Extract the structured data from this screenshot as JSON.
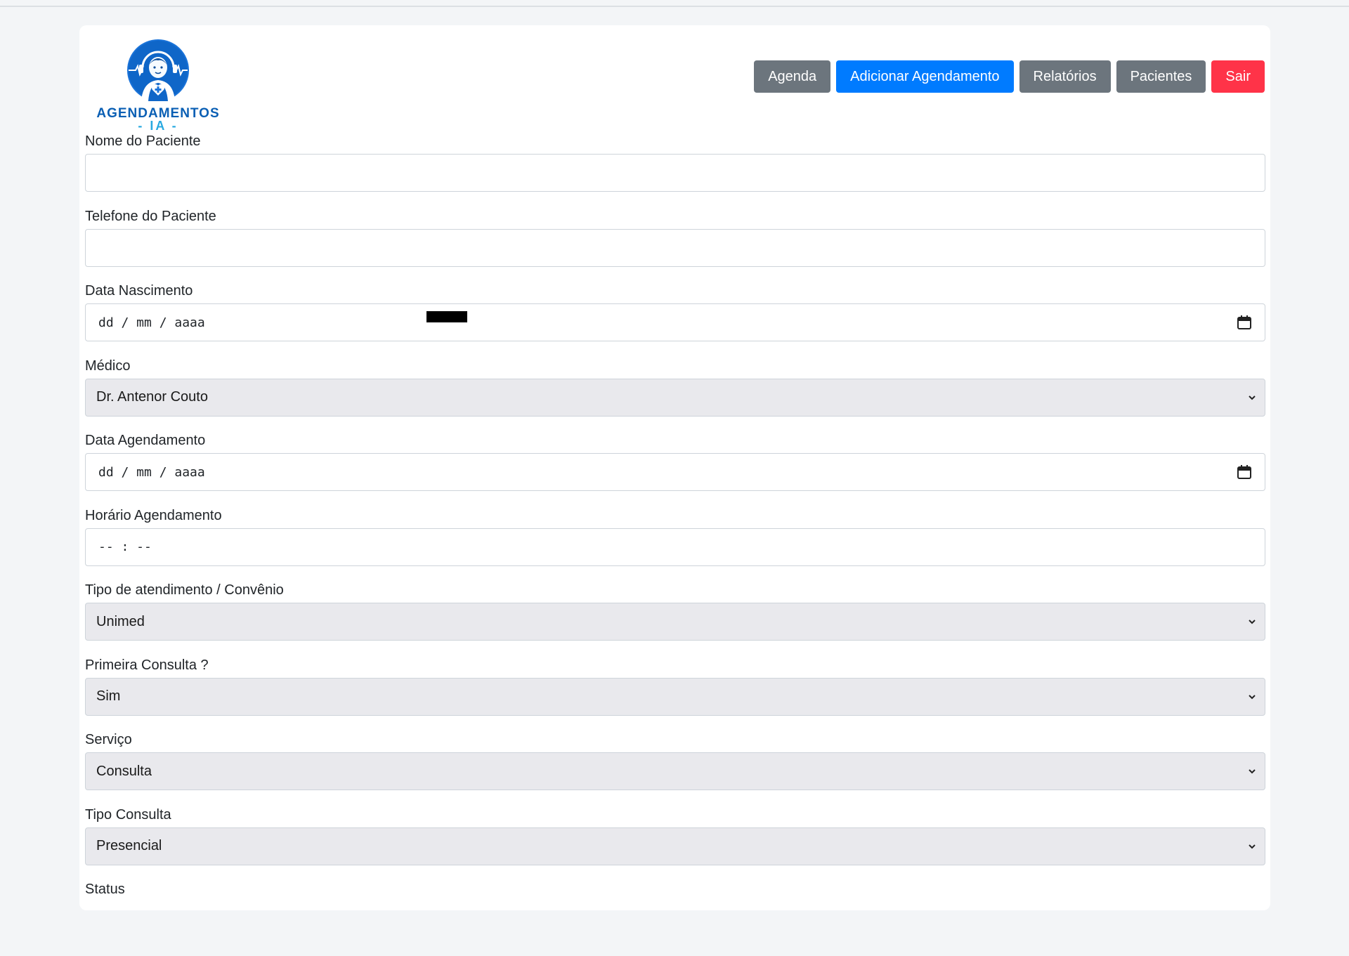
{
  "logo": {
    "line1": "AGENDAMENTOS",
    "line2": "- IA -"
  },
  "nav": {
    "agenda": "Agenda",
    "add": "Adicionar Agendamento",
    "reports": "Relatórios",
    "patients": "Pacientes",
    "logout": "Sair"
  },
  "form": {
    "patient_name": {
      "label": "Nome do Paciente",
      "value": ""
    },
    "patient_phone": {
      "label": "Telefone do Paciente",
      "value": ""
    },
    "birth_date": {
      "label": "Data Nascimento",
      "value": "dd / mm / aaaa"
    },
    "doctor": {
      "label": "Médico",
      "value": "Dr. Antenor Couto"
    },
    "appointment_date": {
      "label": "Data Agendamento",
      "value": "dd / mm / aaaa"
    },
    "appointment_time": {
      "label": "Horário Agendamento",
      "value": "-- : --"
    },
    "insurance": {
      "label": "Tipo de atendimento / Convênio",
      "value": "Unimed"
    },
    "first_visit": {
      "label": "Primeira Consulta ?",
      "value": "Sim"
    },
    "service": {
      "label": "Serviço",
      "value": "Consulta"
    },
    "consult_type": {
      "label": "Tipo Consulta",
      "value": "Presencial"
    },
    "status": {
      "label": "Status"
    }
  },
  "colors": {
    "primary": "#007bff",
    "secondary": "#6c757d",
    "danger": "#ff3348",
    "logo_blue": "#0a5fb4"
  }
}
